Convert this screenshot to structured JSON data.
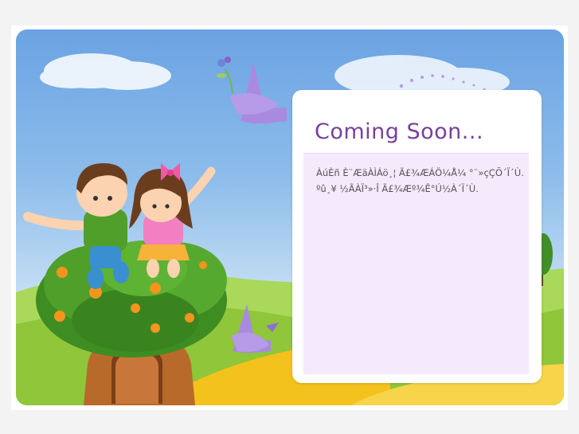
{
  "page": {
    "title": "Coming Soon...",
    "message": "ÀúÈñ È¨ÆäÀÌÁö¸¦ Ã£¾ÆÁÖ¼Å¼­ °¨»çÇÕ´Ï´Ù. ºû¸¥ ½ÃÀÏ³»·Î Ã£¾Æº¾Ê°Ú½À´Ï´Ù."
  },
  "colors": {
    "title": "#7a3f9c",
    "panel_bg": "#ffffff",
    "content_bg": "#f5e9fc",
    "sky_top": "#6aa3e3",
    "grass": "#8fc63a",
    "bird": "#a98ae0",
    "leaves": "#4f9f2a",
    "path": "#f4c21c"
  },
  "illustration": {
    "subject_icons": [
      "cloud-icon",
      "bird-icon",
      "tree-icon",
      "children-icon",
      "hill-icon"
    ]
  }
}
